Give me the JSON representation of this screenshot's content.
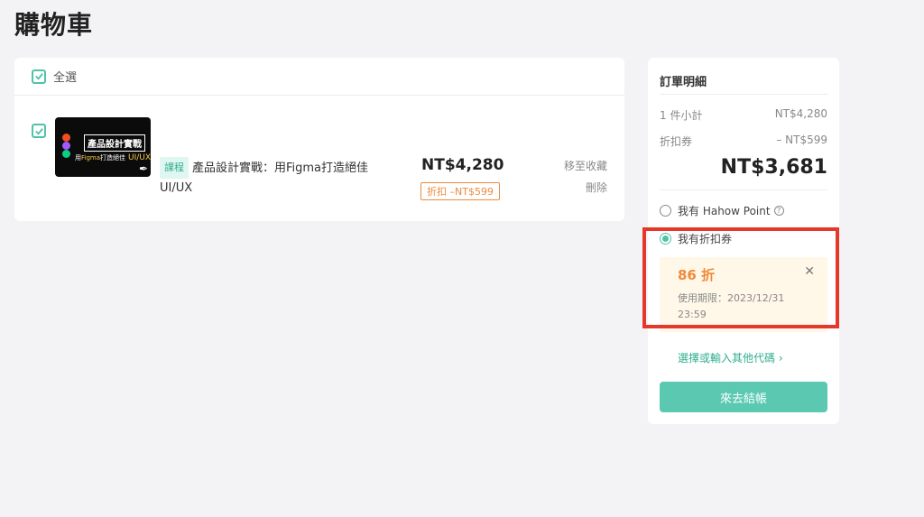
{
  "page": {
    "title": "購物車"
  },
  "cart": {
    "select_all_label": "全選",
    "items": [
      {
        "tag": "課程",
        "title": "產品設計實戰：用Figma打造絕佳UI/UX",
        "thumbnail": {
          "headline": "產品設計實戰",
          "sub_prefix": "用",
          "sub_brand": "Figma",
          "sub_mid": "打造絕佳",
          "sub_suffix": "UI/UX"
        },
        "price": "NT$4,280",
        "discount": "折扣 –NT$599",
        "move_label": "移至收藏",
        "delete_label": "刪除"
      }
    ]
  },
  "summary": {
    "title": "訂單明細",
    "subtotal_label": "1 件小計",
    "subtotal_value": "NT$4,280",
    "coupon_label": "折扣券",
    "coupon_value": "– NT$599",
    "total": "NT$3,681",
    "option_point": "我有 Hahow Point",
    "option_coupon": "我有折扣券",
    "coupon_card": {
      "value": "86 折",
      "expiry": "使用期限：2023/12/31 23:59"
    },
    "other_code": "選擇或輸入其他代碼",
    "checkout": "來去結帳"
  },
  "colors": {
    "accent": "#4fc3a7",
    "discount": "#ef8a3c",
    "highlight": "#e5372a",
    "button": "#5bc9b1"
  }
}
